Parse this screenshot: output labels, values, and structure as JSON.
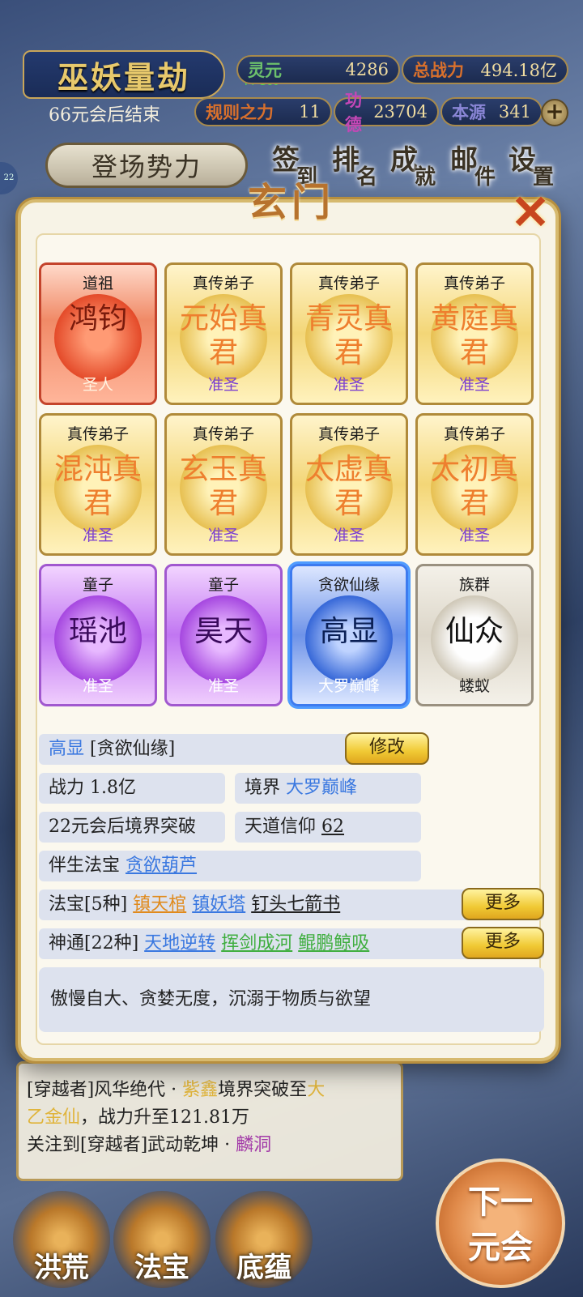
{
  "hud": {
    "title": "巫妖量劫",
    "fps": "FPS60",
    "stats": [
      {
        "label": "灵元",
        "value": "4286"
      },
      {
        "label": "总战力",
        "value": "494.18亿"
      },
      {
        "label": "规则之力",
        "value": "11"
      },
      {
        "label": "功德",
        "value": "23704"
      },
      {
        "label": "本源",
        "value": "341"
      }
    ],
    "end_text": "66元会后结束",
    "plus": "+",
    "side_badge": "22",
    "power_button": "登场势力",
    "menu": [
      {
        "big": "签",
        "small": "到"
      },
      {
        "big": "排",
        "small": "名"
      },
      {
        "big": "成",
        "small": "就"
      },
      {
        "big": "邮",
        "small": "件"
      },
      {
        "big": "设",
        "small": "置"
      }
    ]
  },
  "modal": {
    "title": "玄门",
    "close": "✕",
    "cards": [
      {
        "top": "道祖",
        "name": "鸿钧",
        "bottom": "圣人",
        "style": "red"
      },
      {
        "top": "真传弟子",
        "name": "元始真君",
        "bottom": "准圣",
        "style": "gold"
      },
      {
        "top": "真传弟子",
        "name": "青灵真君",
        "bottom": "准圣",
        "style": "gold"
      },
      {
        "top": "真传弟子",
        "name": "黄庭真君",
        "bottom": "准圣",
        "style": "gold"
      },
      {
        "top": "真传弟子",
        "name": "混沌真君",
        "bottom": "准圣",
        "style": "gold"
      },
      {
        "top": "真传弟子",
        "name": "玄玉真君",
        "bottom": "准圣",
        "style": "gold"
      },
      {
        "top": "真传弟子",
        "name": "太虚真君",
        "bottom": "准圣",
        "style": "gold"
      },
      {
        "top": "真传弟子",
        "name": "太初真君",
        "bottom": "准圣",
        "style": "gold"
      },
      {
        "top": "童子",
        "name": "瑶池",
        "bottom": "准圣",
        "style": "purple"
      },
      {
        "top": "童子",
        "name": "昊天",
        "bottom": "准圣",
        "style": "purple"
      },
      {
        "top": "贪欲仙缘",
        "name": "高显",
        "bottom": "大罗巅峰",
        "style": "blue"
      },
      {
        "top": "族群",
        "name": "仙众",
        "bottom": "蝼蚁",
        "style": "white"
      }
    ],
    "detail": {
      "name": "高显",
      "tag": "[贪欲仙缘]",
      "modify_button": "修改",
      "power_label": "战力",
      "power_value": "1.8亿",
      "realm_label": "境界",
      "realm_value": "大罗巅峰",
      "breakthrough": "22元会后境界突破",
      "faith_label": "天道信仰",
      "faith_value": "62",
      "companion_label": "伴生法宝",
      "companion_value": "贪欲葫芦",
      "treasure_label": "法宝[5种]",
      "treasures": [
        "镇天棺",
        "镇妖塔",
        "钉头七箭书"
      ],
      "skills_label": "神通[22种]",
      "skills": [
        "天地逆转",
        "挥剑成河",
        "鲲鹏鲸吸"
      ],
      "more_button": "更多",
      "description": "傲慢自大、贪婪无度，沉溺于物质与欲望"
    }
  },
  "log": {
    "line1_pre": "[穿越者]风华绝代 · ",
    "line1_name": "紫鑫",
    "line1_post": "境界突破至",
    "line1_realm": "大",
    "line2_realm": "乙金仙",
    "line2_post": "，战力升至121.81万",
    "line3_pre": "关注到[穿越者]武动乾坤 · ",
    "line3_place": "麟洞"
  },
  "bottom_nav": [
    "洪荒",
    "法宝",
    "底蕴"
  ],
  "next_button": {
    "line1": "下一",
    "line2": "元会"
  },
  "colors": {
    "accent_gold": "#d6b96e",
    "link_blue": "#3a78e0",
    "link_orange": "#e08a1c",
    "link_green": "#3fae3f"
  }
}
